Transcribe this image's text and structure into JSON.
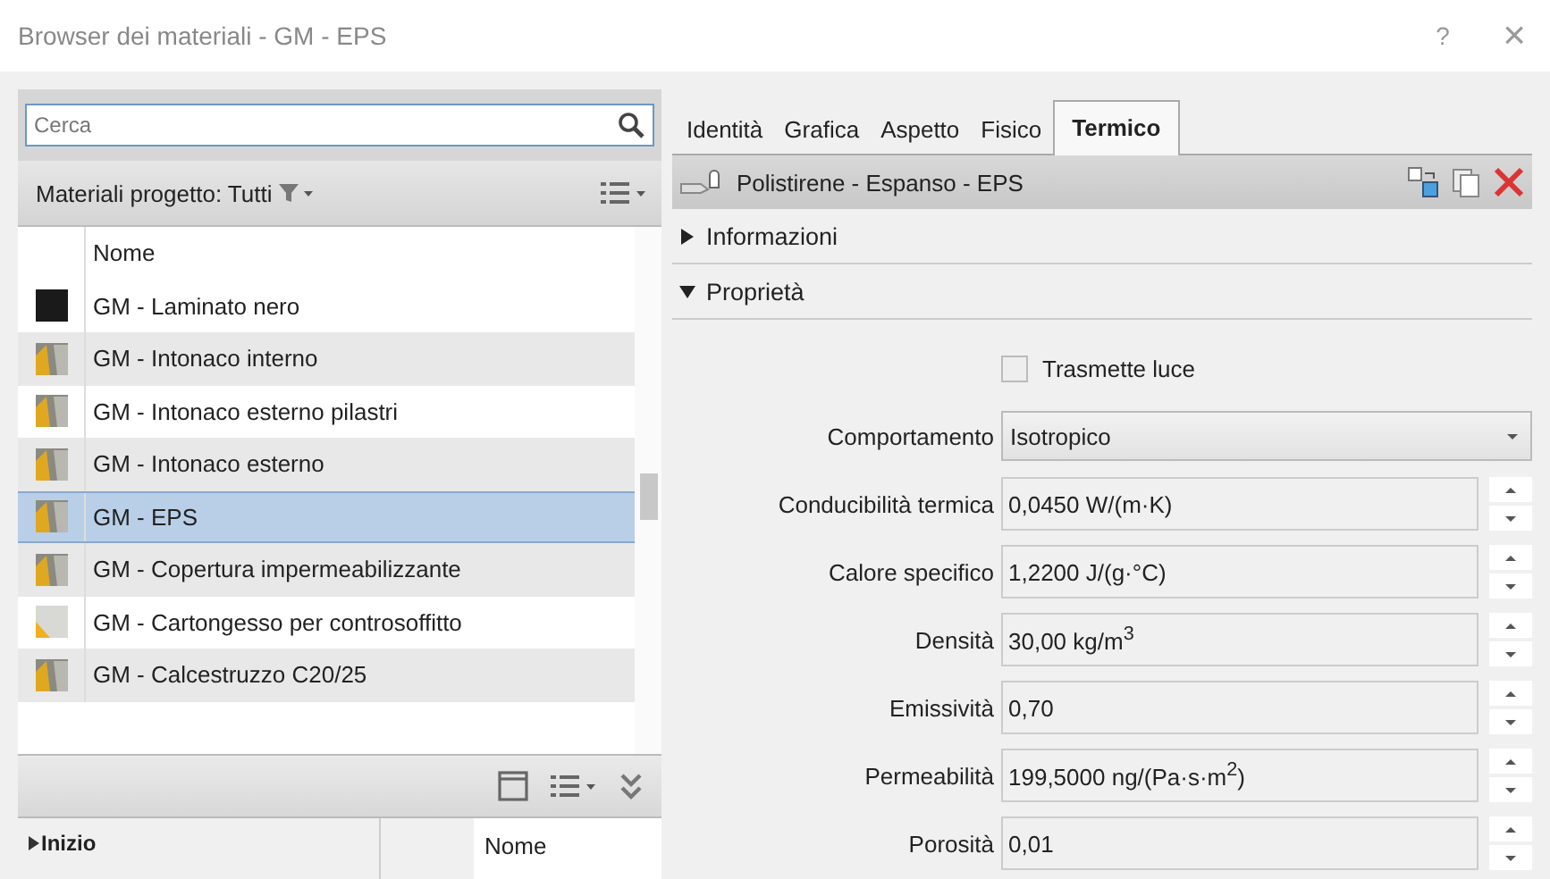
{
  "window": {
    "title": "Browser dei materiali - GM - EPS",
    "help": "?",
    "close": "×"
  },
  "search": {
    "placeholder": "Cerca"
  },
  "filter": {
    "label": "Materiali progetto: Tutti"
  },
  "materials": {
    "column": "Nome",
    "items": [
      {
        "name": "GM - Laminato nero",
        "kind": "solid",
        "selected": false
      },
      {
        "name": "GM - Intonaco interno",
        "kind": "render",
        "selected": false
      },
      {
        "name": "GM - Intonaco esterno pilastri",
        "kind": "render",
        "selected": false
      },
      {
        "name": "GM - Intonaco esterno",
        "kind": "render",
        "selected": false
      },
      {
        "name": "GM - EPS",
        "kind": "render",
        "selected": true
      },
      {
        "name": "GM - Copertura impermeabilizzante",
        "kind": "render",
        "selected": false
      },
      {
        "name": "GM - Cartongesso per controsoffitto",
        "kind": "light",
        "selected": false
      },
      {
        "name": "GM - Calcestruzzo C20/25",
        "kind": "render",
        "selected": false
      }
    ]
  },
  "library": {
    "tree_root": "Inizio",
    "column": "Nome",
    "expanded": false
  },
  "tabs": [
    {
      "label": "Identità",
      "selected": false
    },
    {
      "label": "Grafica",
      "selected": false
    },
    {
      "label": "Aspetto",
      "selected": false
    },
    {
      "label": "Fisico",
      "selected": false
    },
    {
      "label": "Termico",
      "selected": true
    }
  ],
  "asset": {
    "name": "Polistirene - Espanso - EPS"
  },
  "sections": [
    {
      "title": "Informazioni",
      "expanded": false
    },
    {
      "title": "Proprietà",
      "expanded": true
    }
  ],
  "properties": [
    {
      "kind": "checkbox",
      "label": "Trasmette luce",
      "checked": false
    },
    {
      "kind": "dropdown",
      "label": "Comportamento",
      "value": "Isotropico"
    },
    {
      "kind": "spinner",
      "label": "Conducibilità termica",
      "value": "0,0450 W/(m·K)"
    },
    {
      "kind": "spinner",
      "label": "Calore specifico",
      "value": "1,2200 J/(g·°C)"
    },
    {
      "kind": "spinner",
      "label": "Densità",
      "value": "30,00 kg/m$^{3}$"
    },
    {
      "kind": "spinner",
      "label": "Emissività",
      "value": "0,70"
    },
    {
      "kind": "spinner",
      "label": "Permeabilità",
      "value": "199,5000 ng/(Pa·s·m$^{2}$)"
    },
    {
      "kind": "spinner",
      "label": "Porosità",
      "value": "0,01"
    }
  ]
}
